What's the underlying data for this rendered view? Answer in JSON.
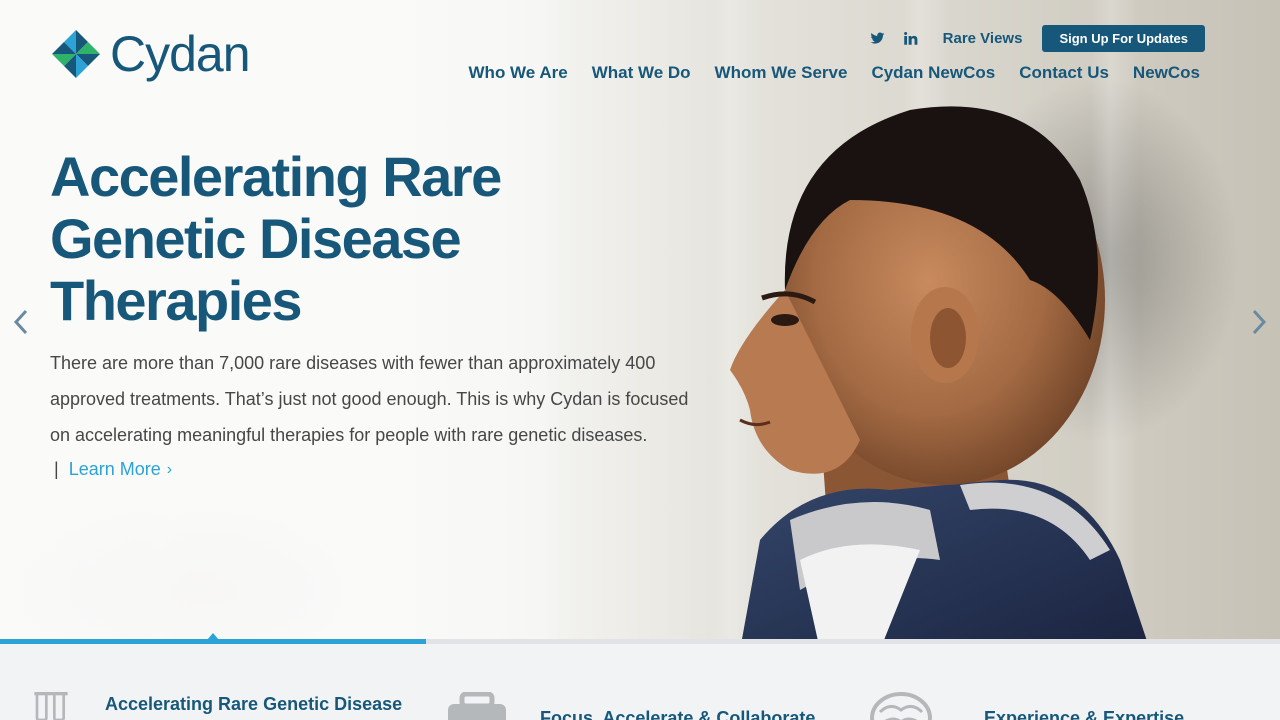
{
  "brand": {
    "name": "Cydan",
    "logo_icon": "pinwheel-logo-icon"
  },
  "utility": {
    "twitter_icon": "twitter-icon",
    "linkedin_icon": "linkedin-icon",
    "rare_views": "Rare Views",
    "signup": "Sign Up For Updates"
  },
  "nav": {
    "items": [
      {
        "label": "Who We Are"
      },
      {
        "label": "What We Do"
      },
      {
        "label": "Whom We Serve"
      },
      {
        "label": "Cydan NewCos"
      },
      {
        "label": "Contact Us"
      },
      {
        "label": "NewCos"
      }
    ]
  },
  "hero": {
    "headline": "Accelerating Rare Genetic Disease Therapies",
    "description": "There are more than 7,000 rare diseases with fewer than approximately 400 approved treatments. That’s just not good enough. This is why Cydan is focused on accelerating meaningful therapies for people with rare genetic diseases.",
    "pipe": "|",
    "learn_more": "Learn More",
    "learn_more_icon": "chevron-right-icon",
    "prev_icon": "chevron-left-icon",
    "next_icon": "chevron-right-icon",
    "slide_progress": 0.333
  },
  "features": [
    {
      "title": "Accelerating Rare Genetic Disease",
      "icon": "test-tubes-icon"
    },
    {
      "title": "Focus, Accelerate & Collaborate",
      "icon": "briefcase-icon"
    },
    {
      "title": "Experience & Expertise",
      "icon": "brain-icon"
    }
  ],
  "colors": {
    "brand_blue": "#17587a",
    "accent_blue": "#2ba3d6",
    "logo_green": "#2fb36b",
    "logo_cyan": "#2ba3d6"
  }
}
